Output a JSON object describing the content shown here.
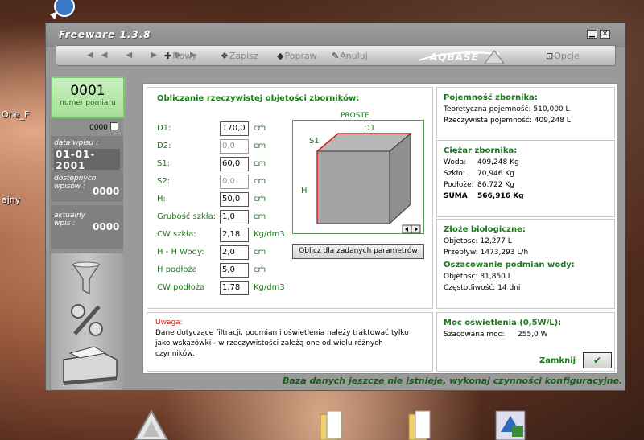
{
  "desktop": {
    "labels": [
      "One_F",
      "ajny"
    ]
  },
  "window": {
    "title": "Freeware 1.3.8",
    "minimize_glyph": "▁",
    "close_glyph": "×"
  },
  "toolbar": {
    "nav": "◀◀ ◀ ▶ ▶▶",
    "new_label": "Nowy",
    "save_label": "Zapisz",
    "edit_label": "Popraw",
    "cancel_label": "Anuluj",
    "logo": "AQBASE",
    "options_label": "Opcje"
  },
  "sidebar": {
    "counter_number": "0001",
    "counter_label": "numer pomiaru",
    "check_value": "0000",
    "date_label": "data wpisu :",
    "date_value": "01-01-2001",
    "available_label": "dostępnych wpisów :",
    "available_value": "0000",
    "current_label": "aktualny wpis :",
    "current_value": "0000"
  },
  "calc": {
    "title": "Obliczanie rzeczywistej objetości zborników:",
    "shape_label": "PROSTE",
    "fields": [
      {
        "label": "D1:",
        "value": "170,0",
        "unit": "cm",
        "disabled": false
      },
      {
        "label": "D2:",
        "value": "0,0",
        "unit": "cm",
        "disabled": true
      },
      {
        "label": "S1:",
        "value": "60,0",
        "unit": "cm",
        "disabled": false
      },
      {
        "label": "S2:",
        "value": "0,0",
        "unit": "cm",
        "disabled": true
      },
      {
        "label": "H:",
        "value": "50,0",
        "unit": "cm",
        "disabled": false
      },
      {
        "label": "Grubość szkła:",
        "value": "1,0",
        "unit": "cm",
        "disabled": false
      },
      {
        "label": "CW szkła:",
        "value": "2,18",
        "unit": "Kg/dm3",
        "disabled": false
      },
      {
        "label": " H - H Wody:",
        "value": "2,0",
        "unit": "cm",
        "disabled": false
      },
      {
        "label": "H podłoża",
        "value": "5,0",
        "unit": "cm",
        "disabled": false
      },
      {
        "label": "CW podłoża",
        "value": "1,78",
        "unit": "Kg/dm3",
        "disabled": false
      }
    ],
    "diagram_labels": {
      "s1": "S1",
      "d1": "D1",
      "h": "H"
    },
    "compute_button": "Oblicz dla zadanych parametrów"
  },
  "warning": {
    "title": "Uwaga:",
    "text": "Dane dotyczące filtracji, podmian i oświetlenia należy traktować tylko jako wskazówki - w rzeczywistości zależą one od wielu różnych czynników."
  },
  "capacity": {
    "title": "Pojemność zbornika:",
    "theoretical": "Teoretyczna pojemność: 510,000 L",
    "real": "Rzeczywista pojemność: 409,248 L"
  },
  "weight": {
    "title": "Ciężar zbornika:",
    "rows": [
      {
        "label": "Woda:",
        "value": "409,248 Kg"
      },
      {
        "label": "Szkło:",
        "value": "70,946 Kg"
      },
      {
        "label": "Podłoże:",
        "value": "86,722 Kg"
      }
    ],
    "sum_label": "SUMA",
    "sum_value": "566,916 Kg"
  },
  "bio": {
    "title": "Złoże biologiczne:",
    "volume": "Objetosc: 12,277 L",
    "flow": "Przepływ: 1473,293 L/h",
    "water_title": "Oszacowanie podmian wody:",
    "water_volume": "Objetosc: 81,850 L",
    "frequency": "Częstotliwość: 14 dni"
  },
  "light": {
    "title": "Moc oświetlenia (0,5W/L):",
    "power_label": "Szacowana moc:",
    "power_value": "255,0 W"
  },
  "close": {
    "label": "Zamknij",
    "glyph": "✔"
  },
  "status": "Baza danych jeszcze nie istnieje, wykonaj czynności konfiguracyjne."
}
